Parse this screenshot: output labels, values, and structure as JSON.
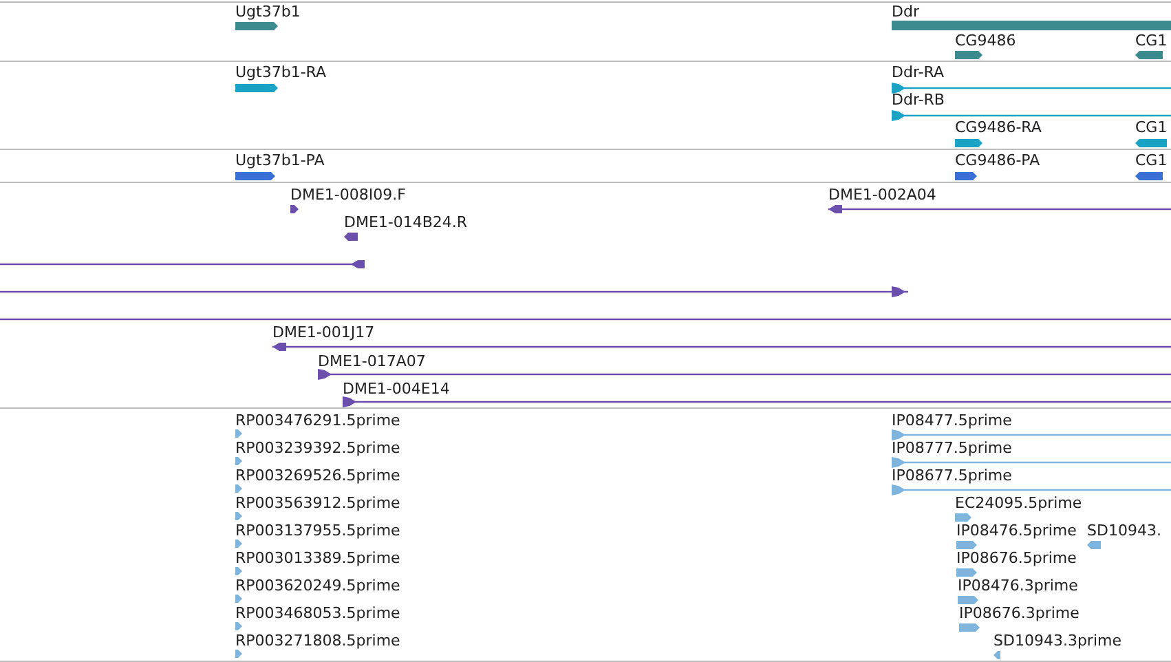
{
  "tracks": [
    {
      "color": "#3c8c8f",
      "features": [
        {
          "label": "Ugt37b1",
          "kind": "block",
          "reverse": false
        },
        {
          "label": "Ddr",
          "kind": "bar"
        },
        {
          "label": "CG9486",
          "kind": "block",
          "reverse": false
        },
        {
          "label": "CG1",
          "kind": "block",
          "reverse": true
        }
      ]
    },
    {
      "color": "#1ba3c6",
      "features": [
        {
          "label": "Ugt37b1-RA",
          "kind": "block",
          "reverse": false
        },
        {
          "label": "Ddr-RA",
          "kind": "line",
          "reverse": false
        },
        {
          "label": "Ddr-RB",
          "kind": "line",
          "reverse": false
        },
        {
          "label": "CG9486-RA",
          "kind": "block",
          "reverse": false
        },
        {
          "label": "CG1",
          "kind": "block",
          "reverse": true
        }
      ]
    },
    {
      "color": "#3a6fd6",
      "features": [
        {
          "label": "Ugt37b1-PA",
          "kind": "block",
          "reverse": false
        },
        {
          "label": "CG9486-PA",
          "kind": "block",
          "reverse": false
        },
        {
          "label": "CG1",
          "kind": "block",
          "reverse": true
        }
      ]
    },
    {
      "color": "#6c4fad",
      "features": [
        {
          "label": "DME1-008I09.F",
          "kind": "block",
          "reverse": false
        },
        {
          "label": "DME1-002A04",
          "kind": "line",
          "reverse": true
        },
        {
          "label": "DME1-014B24.R",
          "kind": "block",
          "reverse": true
        },
        {
          "kind": "line",
          "reverse": true
        },
        {
          "kind": "line",
          "reverse": false
        },
        {
          "kind": "line"
        },
        {
          "label": "DME1-001J17",
          "kind": "line",
          "reverse": true
        },
        {
          "label": "DME1-017A07",
          "kind": "line",
          "reverse": false
        },
        {
          "label": "DME1-004E14",
          "kind": "line",
          "reverse": false
        }
      ]
    },
    {
      "color": "#7fb5dd",
      "features": [
        {
          "label": "RP003476291.5prime",
          "kind": "block",
          "reverse": false
        },
        {
          "label": "RP003239392.5prime",
          "kind": "block",
          "reverse": false
        },
        {
          "label": "RP003269526.5prime",
          "kind": "block",
          "reverse": false
        },
        {
          "label": "RP003563912.5prime",
          "kind": "block",
          "reverse": false
        },
        {
          "label": "RP003137955.5prime",
          "kind": "block",
          "reverse": false
        },
        {
          "label": "RP003013389.5prime",
          "kind": "block",
          "reverse": false
        },
        {
          "label": "RP003620249.5prime",
          "kind": "block",
          "reverse": false
        },
        {
          "label": "RP003468053.5prime",
          "kind": "block",
          "reverse": false
        },
        {
          "label": "RP003271808.5prime",
          "kind": "block",
          "reverse": false
        },
        {
          "label": "IP08477.5prime",
          "kind": "line",
          "reverse": false
        },
        {
          "label": "IP08777.5prime",
          "kind": "line",
          "reverse": false
        },
        {
          "label": "IP08677.5prime",
          "kind": "line",
          "reverse": false
        },
        {
          "label": "EC24095.5prime",
          "kind": "block",
          "reverse": false
        },
        {
          "label": "IP08476.5prime",
          "kind": "block",
          "reverse": false
        },
        {
          "label": "SD10943.",
          "kind": "block",
          "reverse": true
        },
        {
          "label": "IP08676.5prime",
          "kind": "block",
          "reverse": false
        },
        {
          "label": "IP08476.3prime",
          "kind": "block",
          "reverse": false
        },
        {
          "label": "IP08676.3prime",
          "kind": "block",
          "reverse": false
        },
        {
          "label": "SD10943.3prime",
          "kind": "block",
          "reverse": true
        }
      ]
    }
  ]
}
